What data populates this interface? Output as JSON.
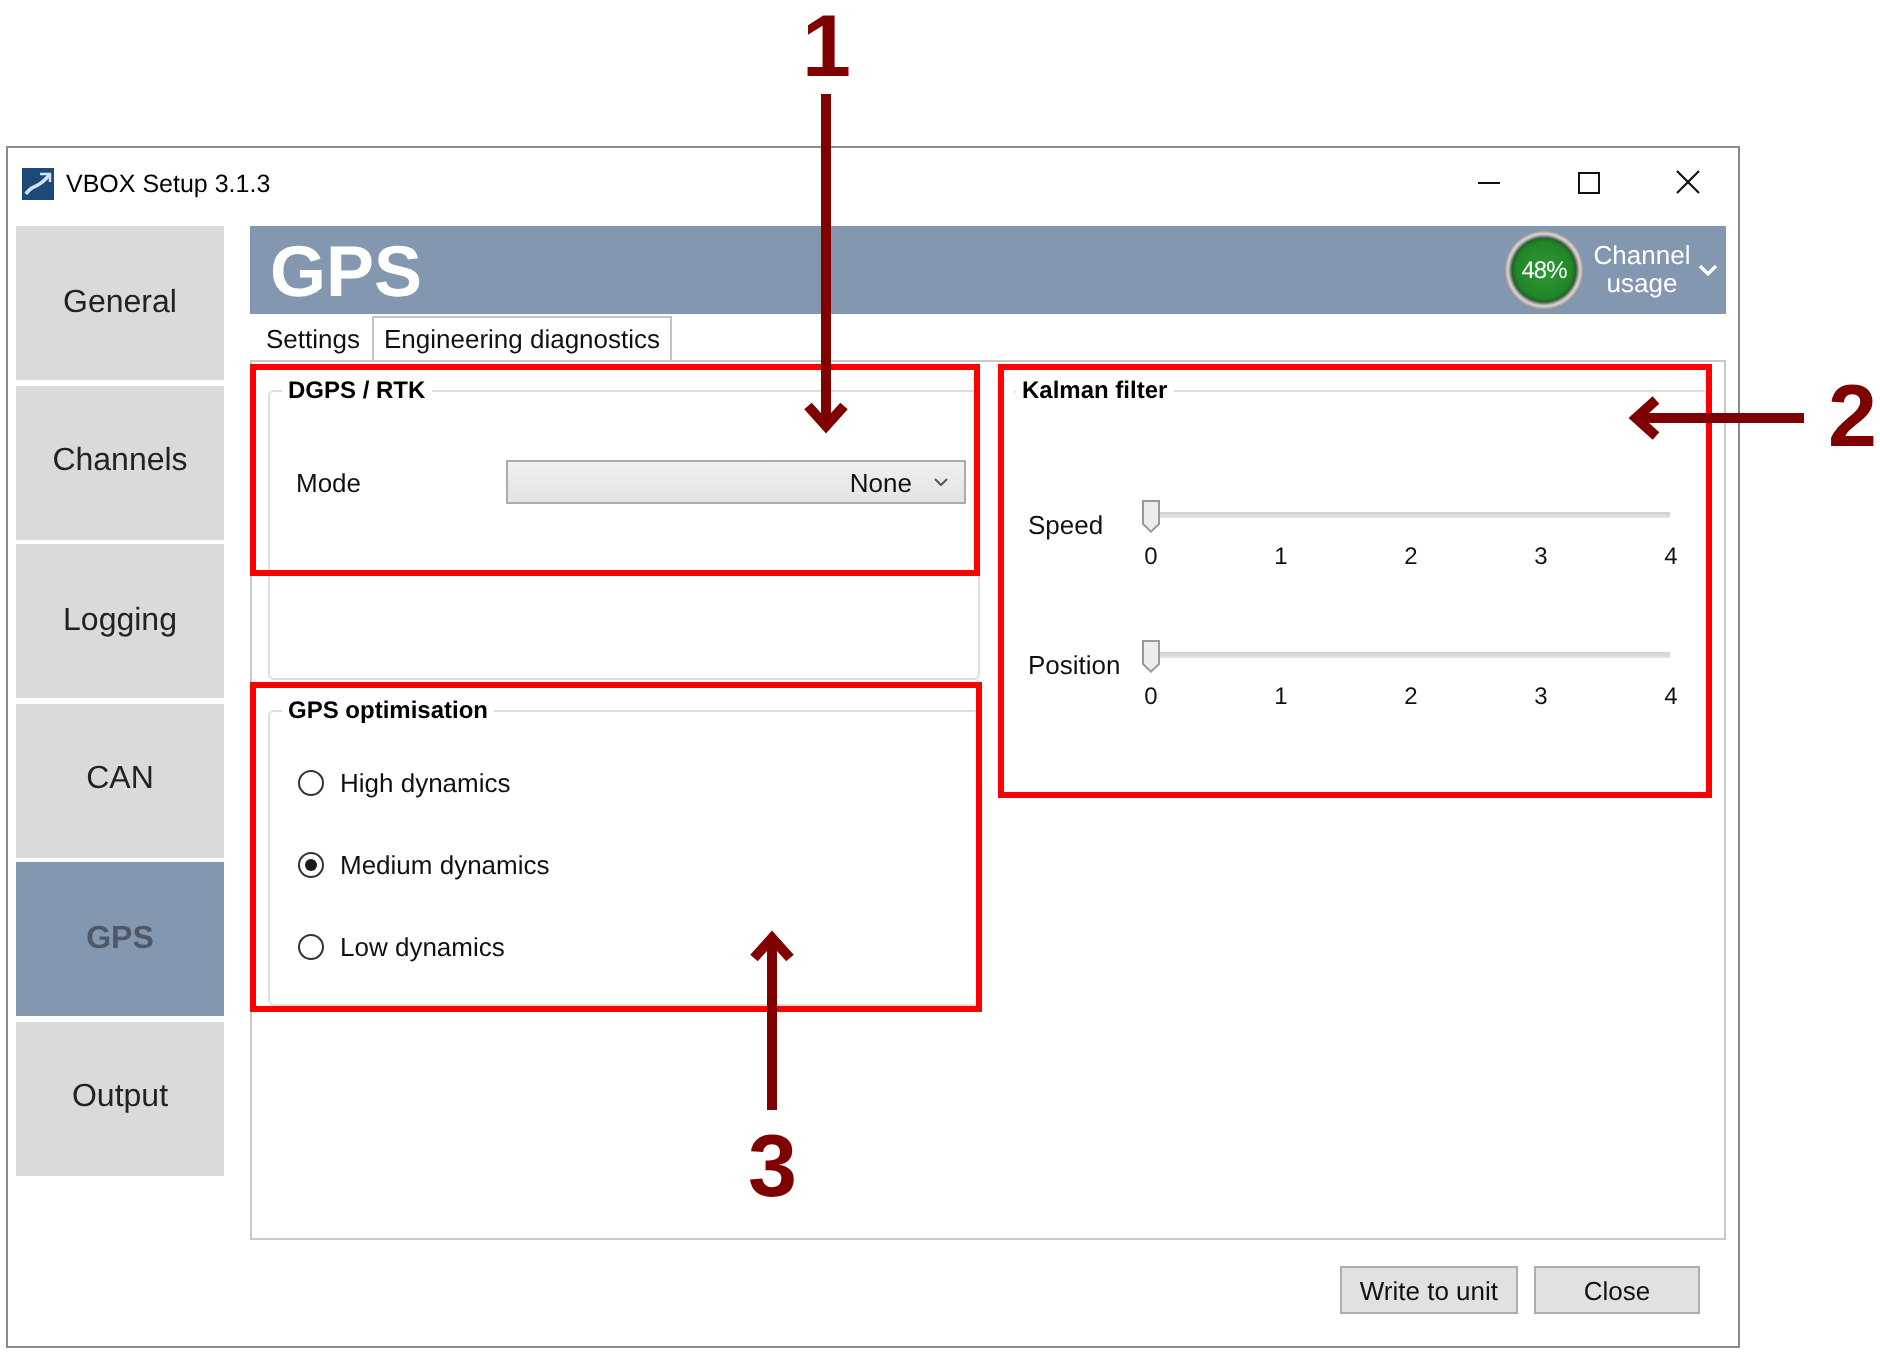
{
  "window": {
    "title": "VBOX Setup 3.1.3"
  },
  "sidebar": {
    "items": [
      {
        "label": "General",
        "selected": false
      },
      {
        "label": "Channels",
        "selected": false
      },
      {
        "label": "Logging",
        "selected": false
      },
      {
        "label": "CAN",
        "selected": false
      },
      {
        "label": "GPS",
        "selected": true
      },
      {
        "label": "Output",
        "selected": false
      }
    ]
  },
  "header": {
    "title": "GPS",
    "channel_usage": {
      "reading": "48%",
      "label": "Channel usage"
    }
  },
  "tabs": [
    {
      "label": "Settings",
      "selected": true
    },
    {
      "label": "Engineering diagnostics",
      "selected": false
    }
  ],
  "dgps_rtk": {
    "title": "DGPS / RTK",
    "mode": {
      "label": "Mode",
      "value": "None"
    }
  },
  "gps_optimisation": {
    "title": "GPS optimisation",
    "options": [
      {
        "label": "High dynamics",
        "selected": false
      },
      {
        "label": "Medium dynamics",
        "selected": true
      },
      {
        "label": "Low dynamics",
        "selected": false
      }
    ]
  },
  "kalman_filter": {
    "title": "Kalman filter",
    "sliders": [
      {
        "label": "Speed",
        "level": 0,
        "ticks": [
          "0",
          "1",
          "2",
          "3",
          "4"
        ]
      },
      {
        "label": "Position",
        "level": 0,
        "ticks": [
          "0",
          "1",
          "2",
          "3",
          "4"
        ]
      }
    ]
  },
  "buttons": [
    "Write to unit",
    "Close"
  ],
  "annotations": [
    {
      "label": "1",
      "kind": "down"
    },
    {
      "label": "2",
      "kind": "left"
    },
    {
      "label": "3",
      "kind": "up"
    }
  ]
}
